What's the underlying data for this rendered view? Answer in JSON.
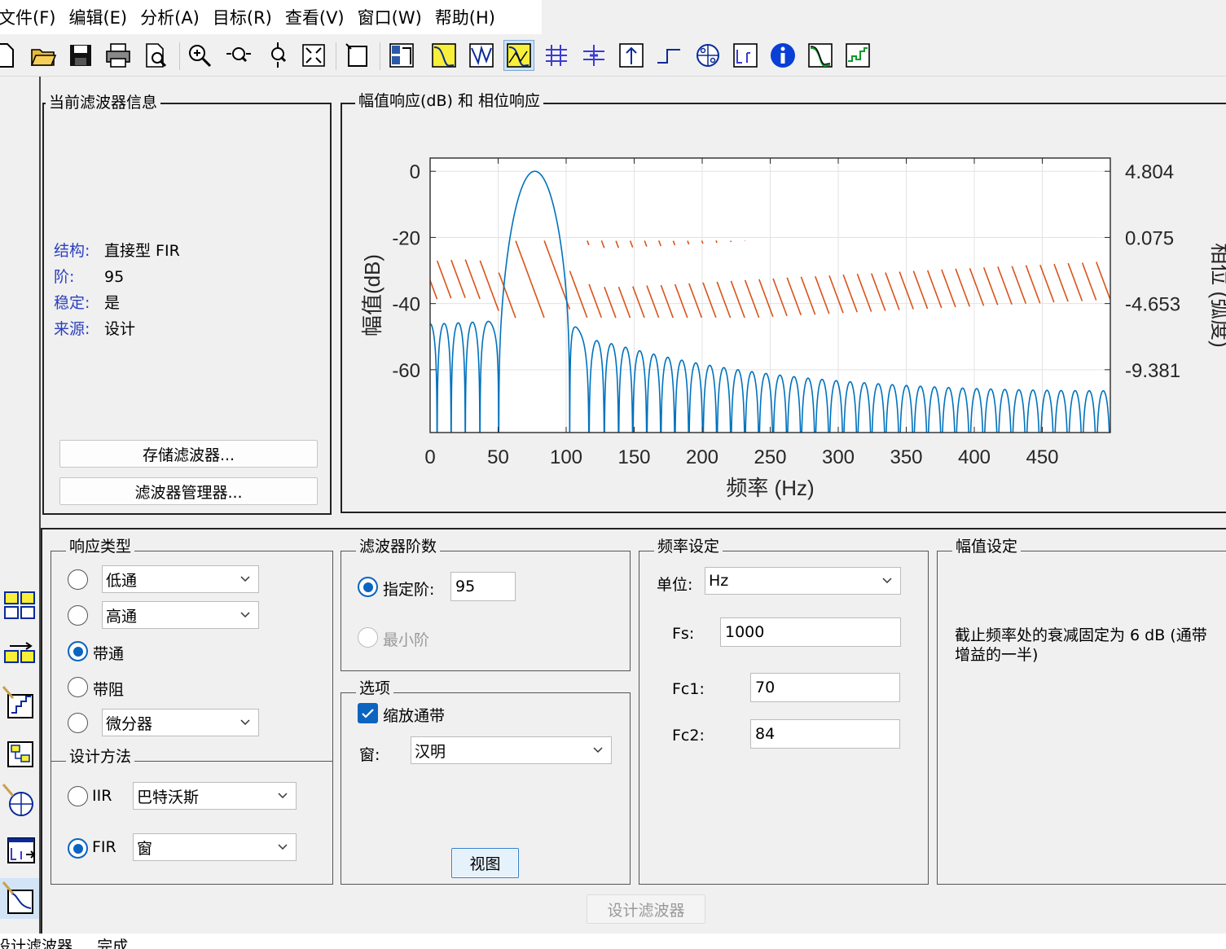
{
  "menu": [
    "文件(F)",
    "编辑(E)",
    "分析(A)",
    "目标(R)",
    "查看(V)",
    "窗口(W)",
    "帮助(H)"
  ],
  "toolbar_icons": [
    "new-file-icon",
    "open-folder-icon",
    "save-icon",
    "print-icon",
    "print-preview-icon",
    "zoom-in-icon",
    "zoom-x-icon",
    "zoom-y-icon",
    "full-view-icon",
    "filter-specs-icon",
    "full-view-analysis-icon",
    "magnitude-response-icon",
    "phase-response-icon",
    "magnitude-phase-response-icon",
    "group-delay-icon",
    "phase-delay-icon",
    "impulse-response-icon",
    "step-response-icon",
    "pole-zero-icon",
    "coefficients-icon",
    "info-icon",
    "magnitude-estimate-icon",
    "round-off-noise-icon"
  ],
  "current_filter": {
    "title": "当前滤波器信息",
    "rows": [
      {
        "key": "结构:",
        "value": "直接型 FIR"
      },
      {
        "key": "阶:",
        "value": "95"
      },
      {
        "key": "稳定:",
        "value": "是"
      },
      {
        "key": "来源:",
        "value": "设计"
      }
    ],
    "store_button": "存储滤波器...",
    "manager_button": "滤波器管理器..."
  },
  "plot": {
    "title": "幅值响应(dB) 和 相位响应",
    "colors": {
      "magnitude": "#0072bd",
      "phase": "#d95319"
    }
  },
  "chart_data": {
    "type": "line",
    "xlabel": "频率 (Hz)",
    "ylabel": "幅值(dB)",
    "y2label": "相位 (弧度)",
    "x_ticks": [
      "0",
      "50",
      "100",
      "150",
      "200",
      "250",
      "300",
      "350",
      "400",
      "450"
    ],
    "y_ticks": [
      "0",
      "-20",
      "-40",
      "-60"
    ],
    "y2_ticks": [
      "4.804",
      "0.075",
      "-4.653",
      "-9.381"
    ],
    "xlim": [
      0,
      500
    ],
    "ylim": [
      -79,
      4
    ],
    "y2lim": [
      -15.5,
      6.8
    ],
    "grid": true,
    "series": [
      {
        "name": "magnitude_db",
        "peak_hz": 77,
        "passband_hz": [
          70,
          84
        ],
        "main_lobe_hz": [
          50,
          101
        ],
        "stopband_level_db": -60
      },
      {
        "name": "phase_rad",
        "start": 0,
        "sawtooth_drop": 3.14
      }
    ]
  },
  "response_type": {
    "title": "响应类型",
    "options": [
      {
        "label": "低通",
        "selected": false,
        "dropdown": true
      },
      {
        "label": "高通",
        "selected": false,
        "dropdown": true
      },
      {
        "label": "带通",
        "selected": true,
        "dropdown": false
      },
      {
        "label": "带阻",
        "selected": false,
        "dropdown": false
      },
      {
        "label": "微分器",
        "selected": false,
        "dropdown": true
      }
    ]
  },
  "design_method": {
    "title": "设计方法",
    "iir_label": "IIR",
    "iir_value": "巴特沃斯",
    "fir_label": "FIR",
    "fir_value": "窗"
  },
  "filter_order": {
    "title": "滤波器阶数",
    "specify_label": "指定阶:",
    "specify_value": "95",
    "minimum_label": "最小阶"
  },
  "options": {
    "title": "选项",
    "scale_label": "缩放通带",
    "window_label": "窗:",
    "window_value": "汉明",
    "view_button": "视图"
  },
  "freq_spec": {
    "title": "频率设定",
    "units_label": "单位:",
    "units_value": "Hz",
    "fs_label": "Fs:",
    "fs_value": "1000",
    "fc1_label": "Fc1:",
    "fc1_value": "70",
    "fc2_label": "Fc2:",
    "fc2_value": "84"
  },
  "mag_spec": {
    "title": "幅值设定",
    "note": "截止频率处的衰减固定为 6 dB (通带增益的一半)"
  },
  "design_button": "设计滤波器",
  "status": "设计滤波器 ... 完成"
}
